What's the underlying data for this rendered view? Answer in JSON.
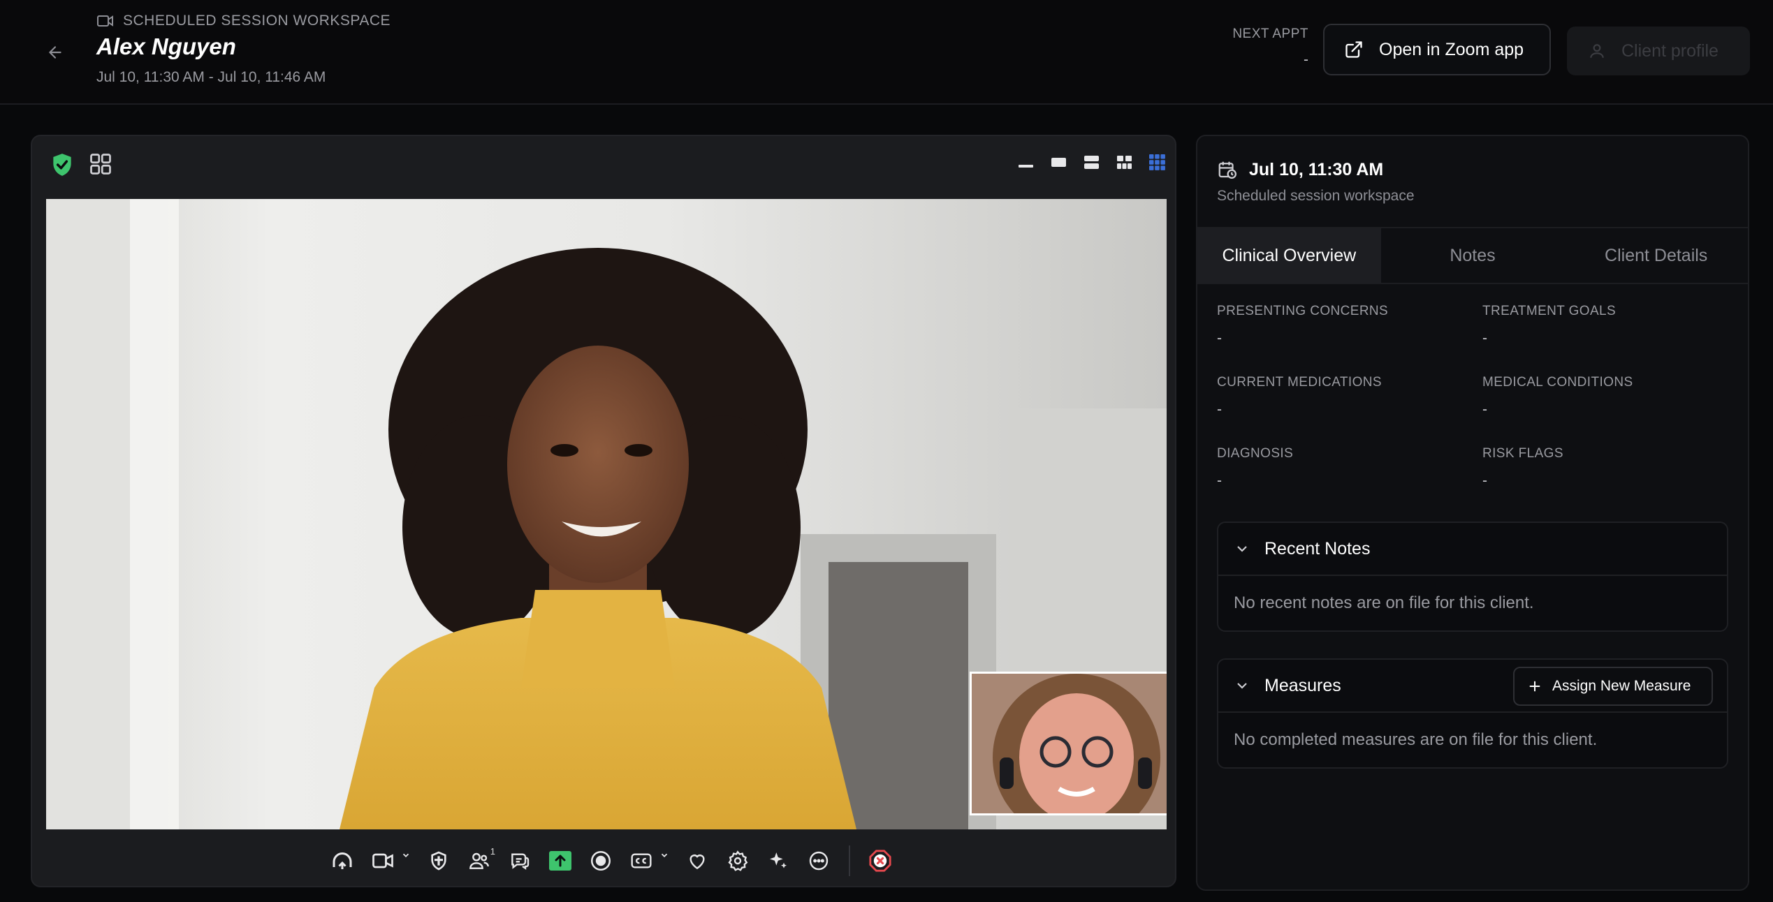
{
  "header": {
    "eyebrow": "SCHEDULED SESSION WORKSPACE",
    "client_name": "Alex Nguyen",
    "session_time": "Jul 10, 11:30 AM - Jul 10, 11:46 AM",
    "next_appt_label": "NEXT APPT",
    "next_appt_value": "-",
    "open_zoom_label": "Open in Zoom app",
    "client_profile_label": "Client profile"
  },
  "video": {
    "participants_count": "1",
    "layout_options": [
      "minimize",
      "speaker",
      "split",
      "grid",
      "gallery"
    ],
    "active_layout": "gallery",
    "toolbar_icons": [
      "audio-icon",
      "video-camera-icon",
      "security-shield-icon",
      "participants-icon",
      "chat-icon",
      "share-screen-icon",
      "record-icon",
      "closed-captions-icon",
      "reactions-icon",
      "settings-icon",
      "ai-companion-icon",
      "more-icon",
      "end-call-icon"
    ]
  },
  "side": {
    "date": "Jul 10, 11:30 AM",
    "subtitle": "Scheduled session workspace",
    "tabs": [
      "Clinical Overview",
      "Notes",
      "Client Details"
    ],
    "active_tab": "Clinical Overview",
    "fields": {
      "presenting_concerns": {
        "label": "PRESENTING CONCERNS",
        "value": "-"
      },
      "treatment_goals": {
        "label": "TREATMENT GOALS",
        "value": "-"
      },
      "current_medications": {
        "label": "CURRENT MEDICATIONS",
        "value": "-"
      },
      "medical_conditions": {
        "label": "MEDICAL CONDITIONS",
        "value": "-"
      },
      "diagnosis": {
        "label": "DIAGNOSIS",
        "value": "-"
      },
      "risk_flags": {
        "label": "RISK FLAGS",
        "value": "-"
      }
    },
    "recent_notes": {
      "title": "Recent Notes",
      "empty": "No recent notes are on file for this client."
    },
    "measures": {
      "title": "Measures",
      "assign_label": "Assign New Measure",
      "empty": "No completed measures are on file for this client."
    }
  },
  "colors": {
    "accent_green": "#3ec46d",
    "accent_blue": "#3b6fd8",
    "end_call_red": "#e5484d",
    "share_green": "#3ec46d"
  }
}
